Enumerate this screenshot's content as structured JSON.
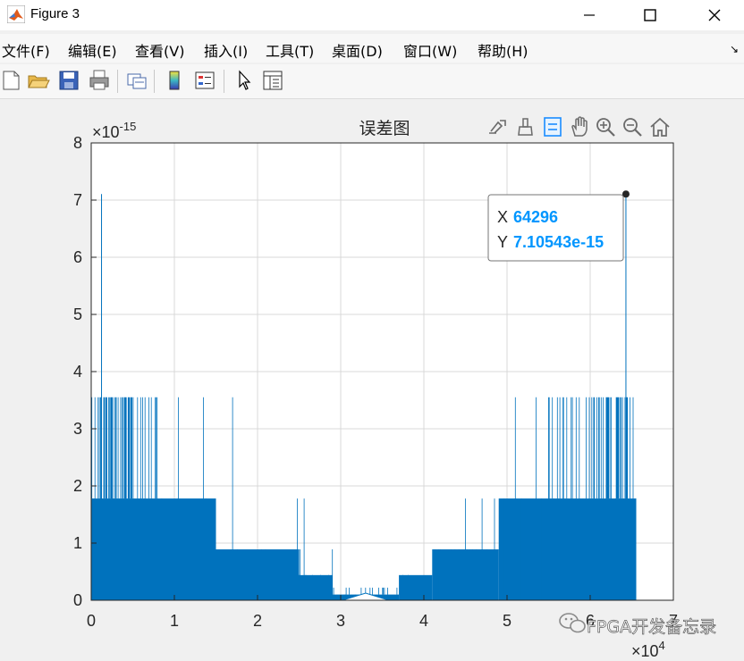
{
  "window": {
    "title": "Figure 3"
  },
  "menu": [
    "文件(F)",
    "编辑(E)",
    "查看(V)",
    "插入(I)",
    "工具(T)",
    "桌面(D)",
    "窗口(W)",
    "帮助(H)"
  ],
  "toolbar": {
    "icons": [
      "new-figure-icon",
      "open-file-icon",
      "save-icon",
      "print-icon",
      "link-plot-icon",
      "insert-colorbar-icon",
      "insert-legend-icon",
      "edit-plot-icon",
      "property-inspector-icon"
    ]
  },
  "axes_toolbar": {
    "icons": [
      "export-icon",
      "brush-icon",
      "data-tips-icon",
      "pan-icon",
      "zoom-in-icon",
      "zoom-out-icon",
      "restore-view-icon"
    ]
  },
  "colors": {
    "series": "#0072bd",
    "datatip_value": "#0096ff",
    "grid": "#d9d9d9"
  },
  "chart_data": {
    "type": "line",
    "title": "误差图",
    "xlabel": "",
    "ylabel": "",
    "xlim": [
      0,
      70000
    ],
    "ylim": [
      0,
      8e-15
    ],
    "x_exponent_label": "×10",
    "x_exponent": "4",
    "y_exponent_label": "×10",
    "y_exponent": "-15",
    "xticks": [
      0,
      10000,
      20000,
      30000,
      40000,
      50000,
      60000,
      70000
    ],
    "xtick_labels": [
      "0",
      "1",
      "2",
      "3",
      "4",
      "5",
      "6",
      "7"
    ],
    "yticks": [
      0,
      1e-15,
      2e-15,
      3e-15,
      4e-15,
      5e-15,
      6e-15,
      7e-15,
      8e-15
    ],
    "ytick_labels": [
      "0",
      "1",
      "2",
      "3",
      "4",
      "5",
      "6",
      "7",
      "8"
    ],
    "grid": true,
    "series": [
      {
        "envelope": [
          {
            "x_range": [
              0,
              8000
            ],
            "y_max": 3.55e-15,
            "dense_floor": 1.78e-15
          },
          {
            "x_range": [
              8000,
              15000
            ],
            "y_max": 1.78e-15,
            "dense_floor": 1.78e-15
          },
          {
            "x_range": [
              15000,
              25000
            ],
            "y_max": 8.9e-16,
            "dense_floor": 8.9e-16
          },
          {
            "x_range": [
              25000,
              29000
            ],
            "y_max": 4.4e-16,
            "dense_floor": 4.4e-16
          },
          {
            "x_range": [
              29000,
              33000
            ],
            "y_max": 2.2e-16,
            "dense_floor": 1e-16
          },
          {
            "x_range": [
              33000,
              37000
            ],
            "y_max": 2.2e-16,
            "dense_floor": 1e-16
          },
          {
            "x_range": [
              37000,
              41000
            ],
            "y_max": 4.4e-16,
            "dense_floor": 4.4e-16
          },
          {
            "x_range": [
              41000,
              49000
            ],
            "y_max": 8.9e-16,
            "dense_floor": 8.9e-16
          },
          {
            "x_range": [
              49000,
              55000
            ],
            "y_max": 1.78e-15,
            "dense_floor": 1.78e-15
          },
          {
            "x_range": [
              55000,
              65536
            ],
            "y_max": 3.55e-15,
            "dense_floor": 1.78e-15
          }
        ],
        "spikes": [
          {
            "x": 1240,
            "y": 7.10543e-15
          },
          {
            "x": 64296,
            "y": 7.10543e-15
          }
        ],
        "x_end": 65536
      }
    ],
    "datatip": {
      "x": 64296,
      "y": 7.10543e-15,
      "x_label": "X",
      "x_value": "64296",
      "y_label": "Y",
      "y_value": "7.10543e-15"
    }
  },
  "watermark": {
    "text": "FPGA开发备忘录"
  }
}
